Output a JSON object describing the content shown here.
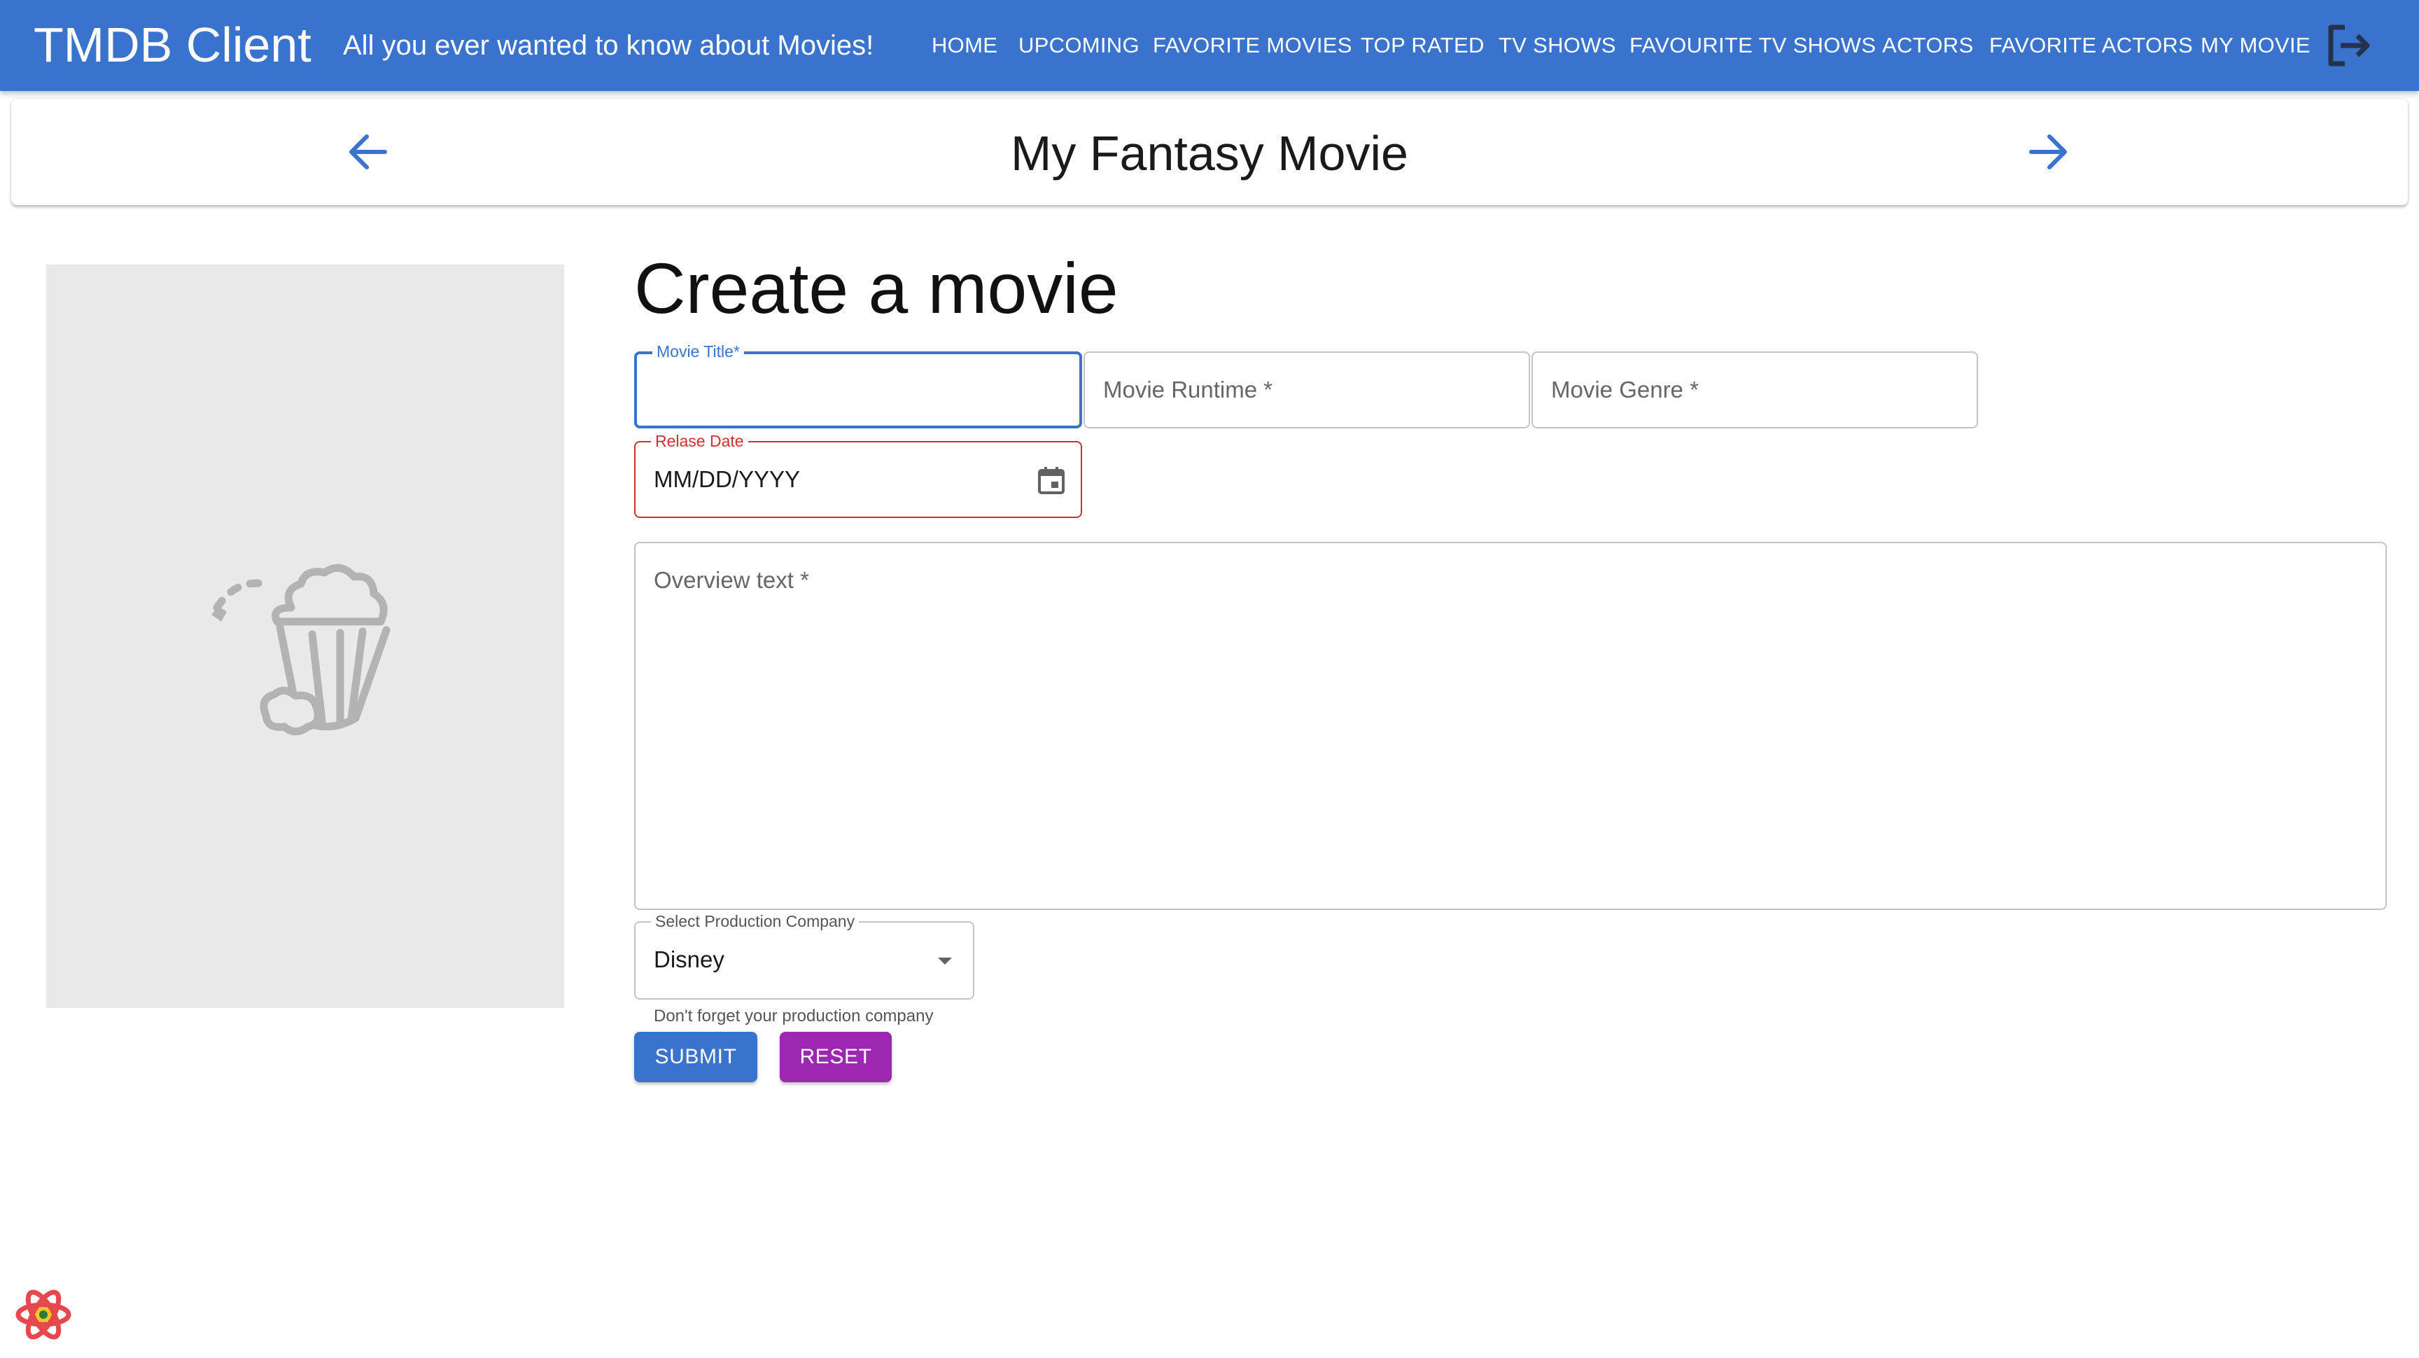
{
  "app": {
    "brand": "TMDB Client",
    "tagline": "All you ever wanted to know about Movies!",
    "nav": [
      "HOME",
      "UPCOMING",
      "FAVORITE MOVIES",
      "TOP RATED",
      "TV SHOWS",
      "FAVOURITE TV SHOWS",
      "ACTORS",
      "FAVORITE ACTORS",
      "MY MOVIE"
    ],
    "logout_icon": "logout-icon"
  },
  "header": {
    "title": "My Fantasy Movie",
    "back_icon": "arrow-back-icon",
    "forward_icon": "arrow-forward-icon"
  },
  "poster": {
    "icon": "popcorn-icon"
  },
  "form": {
    "heading": "Create a movie",
    "title_label": "Movie Title",
    "title_value": "",
    "runtime_label": "Movie Runtime",
    "genre_label": "Movie Genre",
    "required_marker": "*",
    "release_label": "Relase Date",
    "release_value": "MM/DD/YYYY",
    "overview_label": "Overview text",
    "company_label": "Select Production Company",
    "company_value": "Disney",
    "company_helper": "Don't forget your production company",
    "submit_label": "SUBMIT",
    "reset_label": "RESET"
  },
  "colors": {
    "primary": "#3a73cd",
    "secondary": "#9c27b0",
    "error": "#d32f2f",
    "placeholder_bg": "#e9e9e9"
  }
}
